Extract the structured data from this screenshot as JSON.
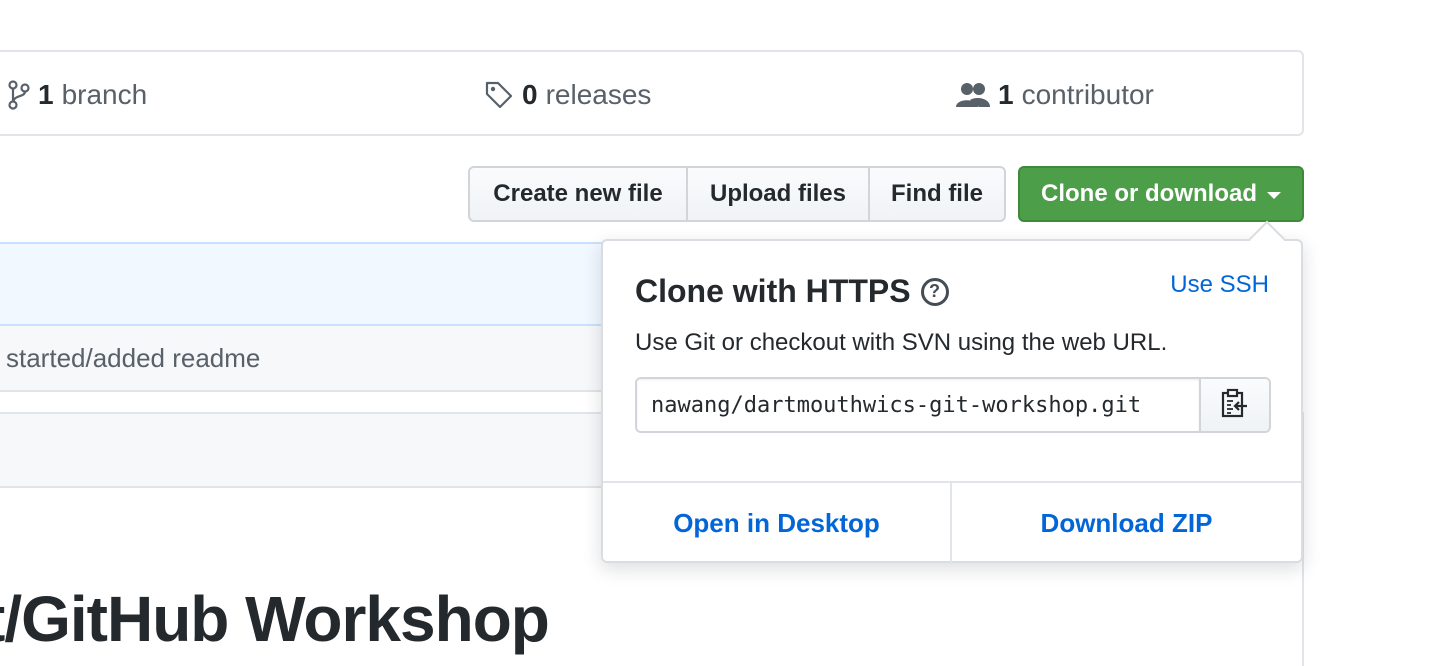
{
  "summary": {
    "branches": {
      "count": "1",
      "label": "branch"
    },
    "releases": {
      "count": "0",
      "label": "releases"
    },
    "contributors": {
      "count": "1",
      "label": "contributor"
    }
  },
  "toolbar": {
    "create_new_file": "Create new file",
    "upload_files": "Upload files",
    "find_file": "Find file",
    "clone_or_download": "Clone or download"
  },
  "file_list": {
    "commit_message": "started/added readme"
  },
  "readme": {
    "title": "t/GitHub Workshop"
  },
  "clone_dropdown": {
    "title": "Clone with HTTPS",
    "help_glyph": "?",
    "use_ssh": "Use SSH",
    "description": "Use Git or checkout with SVN using the web URL.",
    "url_value": "nawang/dartmouthwics-git-workshop.git",
    "open_in_desktop": "Open in Desktop",
    "download_zip": "Download ZIP"
  },
  "icons": {
    "branch": "git-branch-icon",
    "releases": "tag-icon",
    "contributors": "people-icon",
    "copy": "clipboard-icon",
    "help": "question-icon",
    "caret": "caret-down-icon"
  },
  "colors": {
    "accent_blue": "#0366d6",
    "clone_green": "#4d9e48",
    "text": "#24292e",
    "muted": "#586069"
  }
}
